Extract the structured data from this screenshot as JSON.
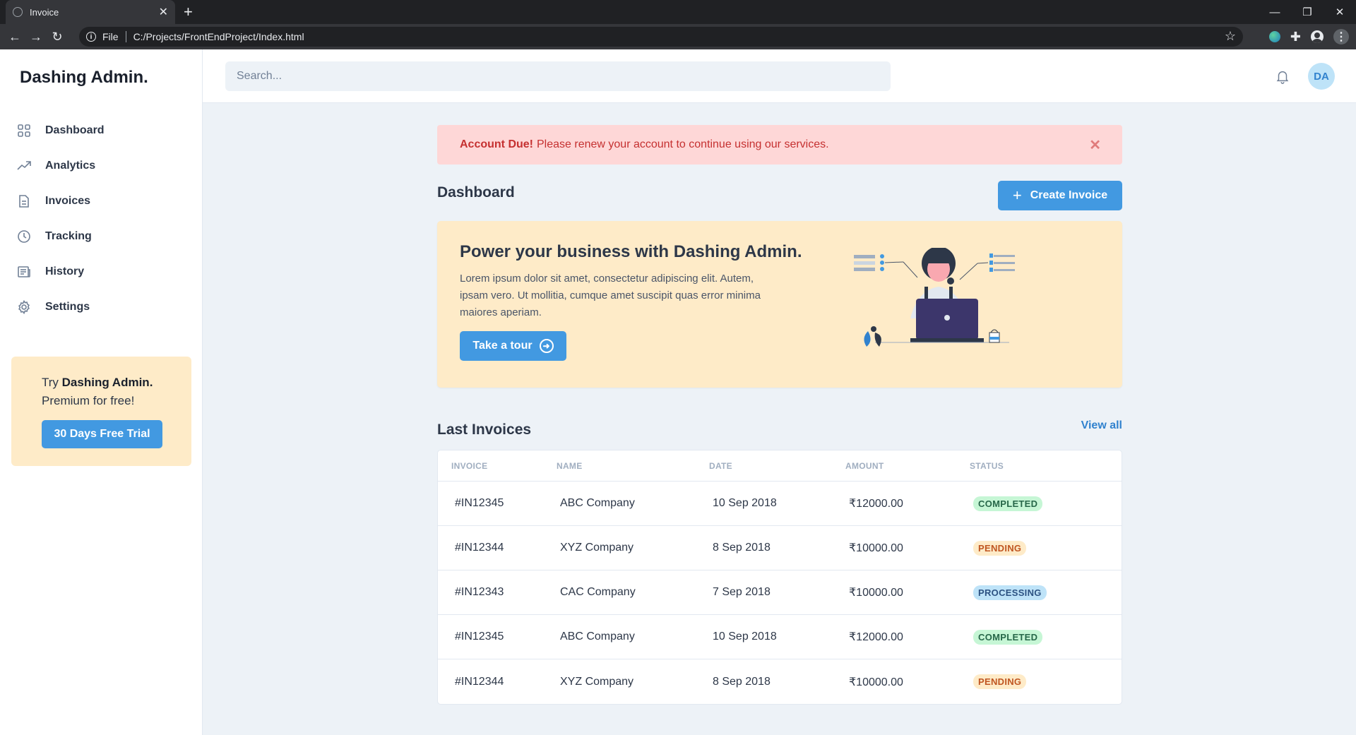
{
  "browser": {
    "tab_title": "Invoice",
    "url_scheme": "File",
    "url": "C:/Projects/FrontEndProject/Index.html"
  },
  "sidebar": {
    "brand": "Dashing Admin.",
    "items": [
      {
        "label": "Dashboard",
        "icon": "grid-icon"
      },
      {
        "label": "Analytics",
        "icon": "trending-up-icon"
      },
      {
        "label": "Invoices",
        "icon": "document-icon"
      },
      {
        "label": "Tracking",
        "icon": "clock-icon"
      },
      {
        "label": "History",
        "icon": "newspaper-icon"
      },
      {
        "label": "Settings",
        "icon": "gear-icon"
      }
    ],
    "promo": {
      "try": "Try",
      "brand": "Dashing Admin.",
      "line2": "Premium for free!",
      "button": "30 Days Free Trial"
    }
  },
  "header": {
    "search_placeholder": "Search...",
    "avatar_initials": "DA"
  },
  "alert": {
    "title": "Account Due!",
    "message": "Please renew your account to continue using our services.",
    "close": "✕"
  },
  "dashboard": {
    "title": "Dashboard",
    "create_button": "Create Invoice"
  },
  "hero": {
    "title": "Power your business with Dashing Admin.",
    "text": "Lorem ipsum dolor sit amet, consectetur adipiscing elit. Autem, ipsam vero. Ut mollitia, cumque amet suscipit quas error minima maiores aperiam.",
    "button": "Take a tour"
  },
  "invoices": {
    "title": "Last Invoices",
    "view_all": "View all",
    "columns": [
      "INVOICE",
      "NAME",
      "DATE",
      "AMOUNT",
      "STATUS"
    ],
    "rows": [
      {
        "invoice": "#IN12345",
        "name": "ABC Company",
        "date": "10 Sep 2018",
        "amount": "₹12000.00",
        "status": "COMPLETED",
        "status_type": "completed"
      },
      {
        "invoice": "#IN12344",
        "name": "XYZ Company",
        "date": "8 Sep 2018",
        "amount": "₹10000.00",
        "status": "PENDING",
        "status_type": "pending"
      },
      {
        "invoice": "#IN12343",
        "name": "CAC Company",
        "date": "7 Sep 2018",
        "amount": "₹10000.00",
        "status": "PROCESSING",
        "status_type": "processing"
      },
      {
        "invoice": "#IN12345",
        "name": "ABC Company",
        "date": "10 Sep 2018",
        "amount": "₹12000.00",
        "status": "COMPLETED",
        "status_type": "completed"
      },
      {
        "invoice": "#IN12344",
        "name": "XYZ Company",
        "date": "8 Sep 2018",
        "amount": "₹10000.00",
        "status": "PENDING",
        "status_type": "pending"
      }
    ]
  },
  "colors": {
    "accent": "#4299e1",
    "alert_bg": "#fed7d7",
    "hero_bg": "#feebc8"
  }
}
